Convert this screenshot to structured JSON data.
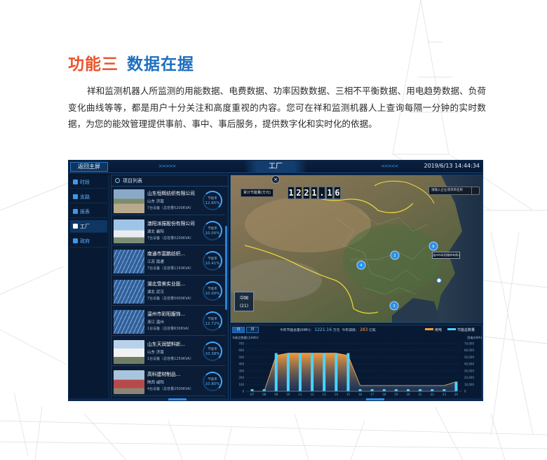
{
  "heading": {
    "number": "功能三",
    "title": "数据在握"
  },
  "intro": "祥和监测机器人所监测的用能数据、电费数据、功率因数数据、三相不平衡数据、用电趋势数据、负荷变化曲线等等，都是用户十分关注和高度重视的内容。您可在祥和监测机器人上查询每隔一分钟的实时数据，为您的能效管理提供事前、事中、事后服务，提供数字化和实时化的依据。",
  "dashboard": {
    "back_label": "返回主屏",
    "left_arrows": ">>>>>",
    "right_arrows": "<<<<<",
    "title": "工厂",
    "datetime": "2019/6/13 14:44:34",
    "nav": [
      {
        "label": "时段",
        "active": false
      },
      {
        "label": "支路",
        "active": false
      },
      {
        "label": "报表",
        "active": false
      },
      {
        "label": "工厂",
        "active": true
      },
      {
        "label": "政府",
        "active": false
      }
    ],
    "list_title": "项目列表",
    "gauge_label": "节能率",
    "items": [
      {
        "name": "山东恒辉纺织有限公司",
        "loc": "山东 济南",
        "cap": "7台设备（总容量5200KVA）",
        "rate": "12.85%",
        "thumb": "t-road"
      },
      {
        "name": "澳阳派振股份有限公司",
        "loc": "湖北 襄阳",
        "cap": "7台设备（总容量5200KVA）",
        "rate": "10.00%",
        "thumb": "t-bldg"
      },
      {
        "name": "南通市富鹏纺织...",
        "loc": "江苏 南通",
        "cap": "7台设备（总容量1150KVA）",
        "rate": "10.41%",
        "thumb": "t-solar"
      },
      {
        "name": "湖北雪美实业股...",
        "loc": "湖北 武汉",
        "cap": "7台设备（总容量5000KVA）",
        "rate": "10.00%",
        "thumb": "t-solar"
      },
      {
        "name": "温州市彩阳服饰...",
        "loc": "浙江 温州",
        "cap": "1台设备（总容量630KVA）",
        "rate": "12.72%",
        "thumb": "t-solar"
      },
      {
        "name": "山东天润塑料新...",
        "loc": "山东 济南",
        "cap": "1台设备（总容量1250KVA）",
        "rate": "10.38%",
        "thumb": "t-road2"
      },
      {
        "name": "高科建材制品...",
        "loc": "陕西 咸阳",
        "cap": "4台设备（总容量2500KVA）",
        "rate": "10.80%",
        "thumb": "t-red"
      }
    ],
    "map": {
      "counter_digits": [
        "1",
        "2",
        "2",
        "1",
        ".",
        "1",
        "6"
      ],
      "chip_label": "累计节能量(万元)",
      "search_placeholder": "请输入企业或项目名称",
      "province_name": "中国",
      "province_count": "(21)",
      "tip": "温州市彩阳服饰有限公司",
      "markers": [
        {
          "label": "4"
        },
        {
          "label": "2"
        },
        {
          "label": "6"
        },
        {
          "label": "3"
        }
      ]
    },
    "chart_tabs": [
      "日",
      "月"
    ],
    "stats": {
      "label1": "今年节能总量(kWh)：",
      "value1": "1221.16",
      "unit1": "万元",
      "label2": "今年减排：",
      "value2": "283",
      "unit2": "亿吨"
    },
    "legend": [
      {
        "name": "用电",
        "color": "#ff9f3a"
      },
      {
        "name": "节能总数量",
        "color": "#4dd2ff"
      }
    ]
  },
  "chart_data": {
    "type": "bar",
    "ylabel": "节能总数量(万kWh)",
    "y2label": "用电(kWh)",
    "categories": [
      "07",
      "08",
      "09",
      "10",
      "11",
      "12",
      "13",
      "14",
      "15",
      "16",
      "17",
      "18",
      "19",
      "20",
      "21",
      "22",
      "23",
      "24"
    ],
    "series": [
      {
        "name": "节能总数量",
        "kind": "bar",
        "color": "#4dd2ff",
        "values": [
          0,
          0,
          8,
          8,
          8,
          8,
          8,
          8,
          8,
          0,
          0,
          0,
          0,
          0,
          0,
          0,
          0,
          2
        ]
      },
      {
        "name": "用电",
        "kind": "area",
        "color": "#ff9f3a",
        "values": [
          0,
          0,
          7.5,
          8,
          8,
          8,
          8,
          8,
          7.5,
          1.2,
          1.2,
          1.2,
          1.2,
          1.2,
          1.2,
          1.2,
          1.2,
          2
        ]
      }
    ],
    "ylim": [
      0,
      10
    ],
    "yticks": [
      "0",
      "100",
      "200",
      "300",
      "400",
      "500",
      "600",
      "700"
    ],
    "y2ticks": [
      "0",
      "10,000",
      "20,000",
      "30,000",
      "40,000",
      "50,000",
      "60,000",
      "70,000"
    ]
  }
}
